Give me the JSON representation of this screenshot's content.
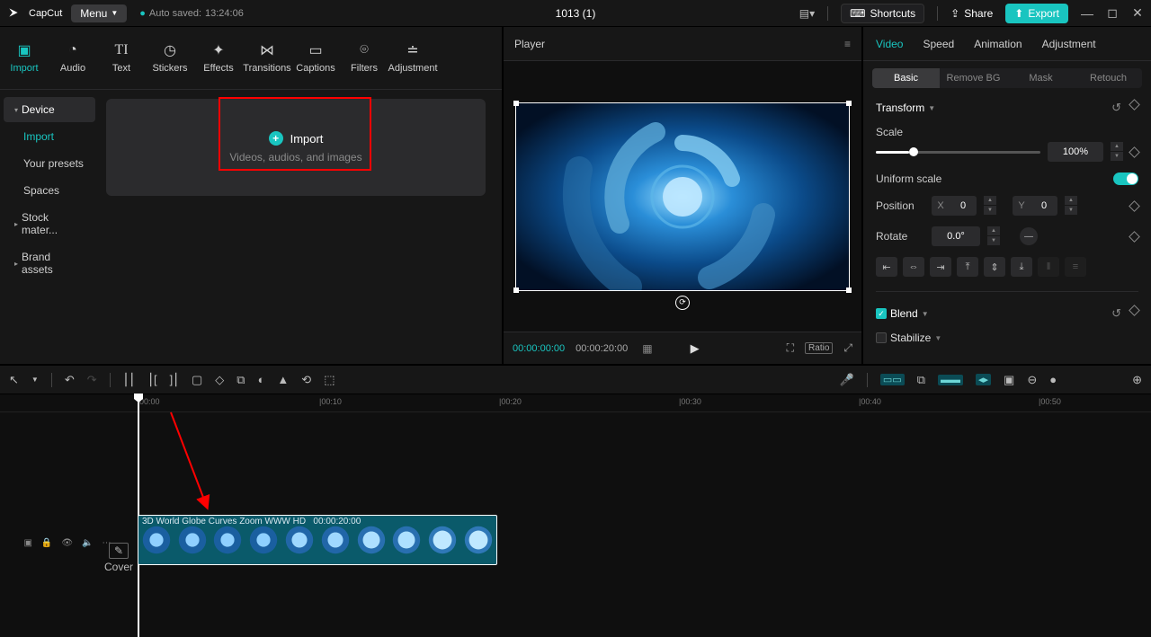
{
  "topbar": {
    "brand": "CapCut",
    "menu": "Menu",
    "autosave_prefix": "Auto saved:",
    "autosave_time": "13:24:06",
    "project_title": "1013 (1)",
    "shortcuts": "Shortcuts",
    "share": "Share",
    "export": "Export"
  },
  "tool_tabs": [
    {
      "icon": "▣",
      "label": "Import"
    },
    {
      "icon": "◔",
      "label": "Audio"
    },
    {
      "icon": "T I",
      "label": "Text"
    },
    {
      "icon": "◷",
      "label": "Stickers"
    },
    {
      "icon": "✦",
      "label": "Effects"
    },
    {
      "icon": "⋈",
      "label": "Transitions"
    },
    {
      "icon": "▭",
      "label": "Captions"
    },
    {
      "icon": "⌘",
      "label": "Filters"
    },
    {
      "icon": "⇄",
      "label": "Adjustment"
    }
  ],
  "media_side": {
    "device": "Device",
    "import": "Import",
    "presets": "Your presets",
    "spaces": "Spaces",
    "stock": "Stock mater...",
    "brand": "Brand assets"
  },
  "import_box": {
    "title": "Import",
    "subtitle": "Videos, audios, and images"
  },
  "player": {
    "title": "Player",
    "time_current": "00:00:00:00",
    "time_duration": "00:00:20:00",
    "ratio": "Ratio"
  },
  "right_panel": {
    "tabs": [
      "Video",
      "Speed",
      "Animation",
      "Adjustment"
    ],
    "subtabs": [
      "Basic",
      "Remove BG",
      "Mask",
      "Retouch"
    ],
    "transform": "Transform",
    "scale": "Scale",
    "scale_value": "100%",
    "uniform": "Uniform scale",
    "position": "Position",
    "pos_x": "0",
    "pos_y": "0",
    "rotate": "Rotate",
    "rotate_value": "0.0°",
    "blend": "Blend",
    "stabilize": "Stabilize"
  },
  "timeline": {
    "ticks": [
      "00:00",
      "|00:10",
      "|00:20",
      "|00:30",
      "|00:40",
      "|00:50"
    ],
    "cover": "Cover",
    "clip_name": "3D World Globe Curves Zoom WWW HD",
    "clip_dur": "00:00:20:00"
  }
}
